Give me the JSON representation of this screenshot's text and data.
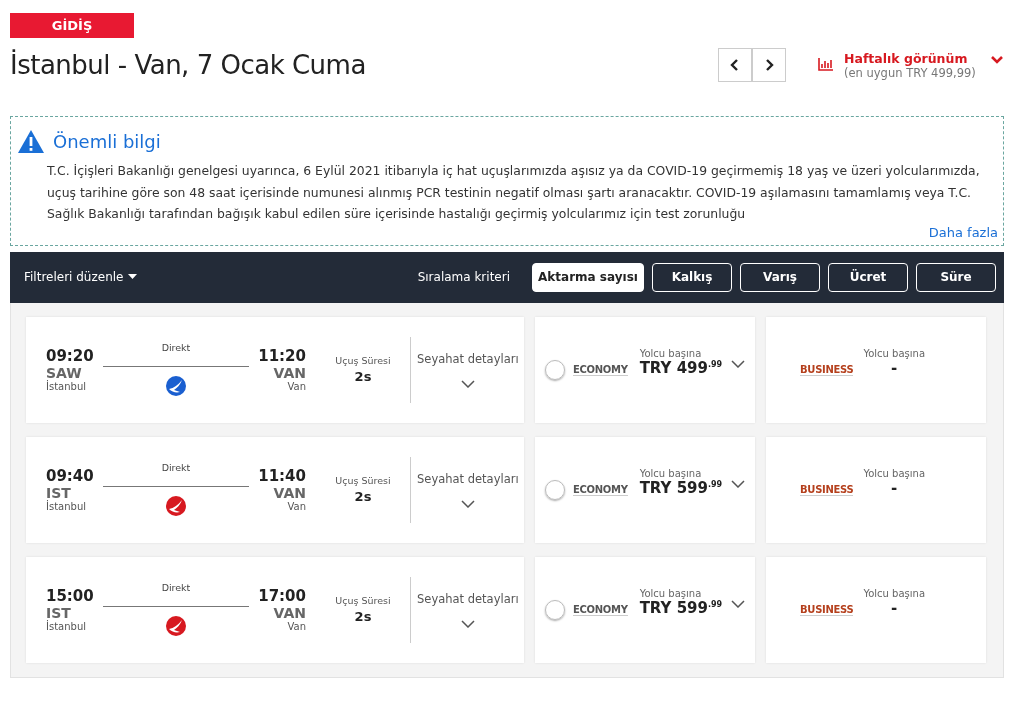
{
  "direction_badge": "GİDİŞ",
  "title": "İstanbul - Van, 7 Ocak Cuma",
  "weekly_view": {
    "label": "Haftalık görünüm",
    "sublabel": "(en uygun TRY 499,99)"
  },
  "notice": {
    "title": "Önemli bilgi",
    "text": "T.C. İçişleri Bakanlığı genelgesi uyarınca, 6 Eylül 2021 itibarıyla iç hat uçuşlarımızda aşısız ya da COVID-19 geçirmemiş 18 yaş ve üzeri yolcularımızda, uçuş tarihine göre son 48 saat içerisinde numunesi alınmış PCR testinin negatif olması şartı aranacaktır. COVID-19 aşılamasını tamamlamış veya T.C. Sağlık Bakanlığı tarafından bağışık kabul edilen süre içerisinde hastalığı geçirmiş yolcularımız için test zorunluğu",
    "more_link": "Daha fazla"
  },
  "toolbar": {
    "filters": "Filtreleri düzenle",
    "sort_label": "Sıralama kriteri",
    "sort_options": [
      {
        "label": "Aktarma sayısı",
        "selected": true
      },
      {
        "label": "Kalkış",
        "selected": false
      },
      {
        "label": "Varış",
        "selected": false
      },
      {
        "label": "Ücret",
        "selected": false
      },
      {
        "label": "Süre",
        "selected": false
      }
    ]
  },
  "flights": [
    {
      "dep_time": "09:20",
      "dep_code": "SAW",
      "dep_city": "İstanbul",
      "stops": "Direkt",
      "arr_time": "11:20",
      "arr_code": "VAN",
      "arr_city": "Van",
      "color": "#1a5fd0",
      "duration_label": "Uçuş Süresi",
      "duration": "2s",
      "details": "Seyahat detayları",
      "economy": {
        "brand": "ECONOMY",
        "per": "Yolcu başına",
        "price": "TRY 499$^{.99}$",
        "selected": false
      },
      "business": {
        "brand": "BUSINESS",
        "per": "Yolcu başına",
        "price": "-"
      }
    },
    {
      "dep_time": "09:40",
      "dep_code": "IST",
      "dep_city": "İstanbul",
      "stops": "Direkt",
      "arr_time": "11:40",
      "arr_code": "VAN",
      "arr_city": "Van",
      "color": "#d71920",
      "duration_label": "Uçuş Süresi",
      "duration": "2s",
      "details": "Seyahat detayları",
      "economy": {
        "brand": "ECONOMY",
        "per": "Yolcu başına",
        "price": "TRY 599$^{.99}$",
        "selected": false
      },
      "business": {
        "brand": "BUSINESS",
        "per": "Yolcu başına",
        "price": "-"
      }
    },
    {
      "dep_time": "15:00",
      "dep_code": "IST",
      "dep_city": "İstanbul",
      "stops": "Direkt",
      "arr_time": "17:00",
      "arr_code": "VAN",
      "arr_city": "Van",
      "color": "#d71920",
      "duration_label": "Uçuş Süresi",
      "duration": "2s",
      "details": "Seyahat detayları",
      "economy": {
        "brand": "ECONOMY",
        "per": "Yolcu başına",
        "price": "TRY 599$^{.99}$",
        "selected": false
      },
      "business": {
        "brand": "BUSINESS",
        "per": "Yolcu başına",
        "price": "-"
      }
    }
  ]
}
